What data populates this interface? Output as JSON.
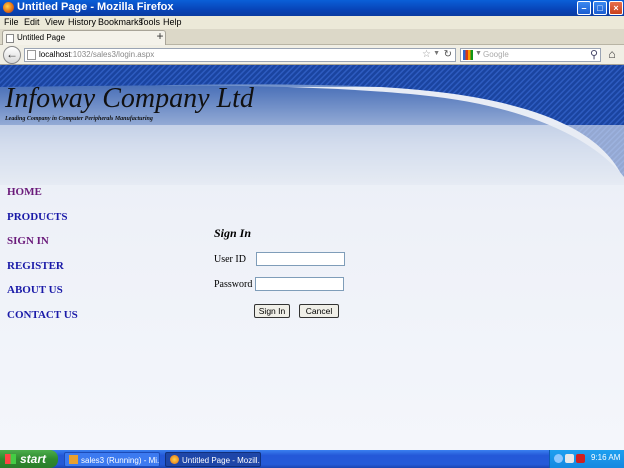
{
  "window": {
    "title": "Untitled Page - Mozilla Firefox",
    "minimize_icon": "minimize-icon",
    "maximize_icon": "maximize-icon",
    "close_icon": "close-icon"
  },
  "menu": [
    "File",
    "Edit",
    "View",
    "History",
    "Bookmarks",
    "Tools",
    "Help"
  ],
  "tab": {
    "label": "Untitled Page",
    "new_tab": "+"
  },
  "navbar": {
    "url_host": "localhost",
    "url_path": ":1032/sales3/login.aspx",
    "search_placeholder": "Google"
  },
  "site": {
    "company": "Infoway Company Ltd",
    "tagline": "Leading Company in Computer Peripherals Manufacturing"
  },
  "nav": {
    "items": [
      "HOME",
      "PRODUCTS",
      "SIGN IN",
      "REGISTER",
      "ABOUT US",
      "CONTACT US"
    ]
  },
  "signin": {
    "title": "Sign In",
    "userid_label": "User ID",
    "password_label": "Password",
    "userid_value": "",
    "password_value": "",
    "signin_button": "Sign In",
    "cancel_button": "Cancel"
  },
  "taskbar": {
    "start": "start",
    "tasks": [
      "sales3 (Running) - Mi...",
      "Untitled Page - Mozill..."
    ],
    "clock": "9:16 AM"
  },
  "colors": {
    "banner_blue": "#1c50b0",
    "nav_link": "#1a1aa8",
    "nav_visited": "#6a1a7a",
    "taskbar": "#245ad8"
  }
}
